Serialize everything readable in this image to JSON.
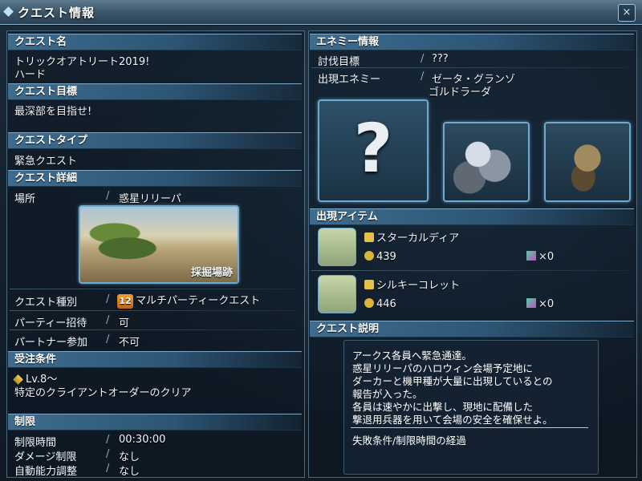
{
  "window": {
    "title": "クエスト情報",
    "close_icon": "×"
  },
  "left": {
    "quest_name": {
      "header": "クエスト名",
      "line1": "トリックオアトリート2019!",
      "line2": "ハード"
    },
    "quest_goal": {
      "header": "クエスト目標",
      "text": "最深部を目指せ!"
    },
    "quest_type": {
      "header": "クエストタイプ",
      "text": "緊急クエスト"
    },
    "quest_detail": {
      "header": "クエスト詳細",
      "location_label": "場所",
      "location_value": "惑星リリーパ",
      "area_caption": "採掘場跡",
      "kind_label": "クエスト種別",
      "kind_value": "マルチパーティークエスト",
      "kind_badge": "12",
      "party_invite_label": "パーティー招待",
      "party_invite_value": "可",
      "partner_label": "パートナー参加",
      "partner_value": "不可"
    },
    "conditions": {
      "header": "受注条件",
      "level": "Lv.8～",
      "order": "特定のクライアントオーダーのクリア"
    },
    "limits": {
      "header": "制限",
      "time_label": "制限時間",
      "time_value": "00:30:00",
      "damage_label": "ダメージ制限",
      "damage_value": "なし",
      "auto_label": "自動能力調整",
      "auto_value": "なし"
    },
    "slash": "/"
  },
  "right": {
    "enemy": {
      "header": "エネミー情報",
      "target_label": "討伐目標",
      "target_value": "???",
      "appear_label": "出現エネミー",
      "appear_value1": "ゼータ・グランゾ",
      "appear_value2": "ゴルドラーダ",
      "unknown_mark": "?"
    },
    "items": {
      "header": "出現アイテム",
      "list": [
        {
          "name": "スターカルディア",
          "count": "439",
          "owned": "×0"
        },
        {
          "name": "シルキーコレット",
          "count": "446",
          "owned": "×0"
        }
      ]
    },
    "description": {
      "header": "クエスト説明",
      "lines": [
        "アークス各員へ緊急通達。",
        "惑星リリーパのハロウィン会場予定地に",
        "ダーカーと機甲種が大量に出現しているとの",
        "報告が入った。",
        "各員は速やかに出撃し、現地に配備した",
        "撃退用兵器を用いて会場の安全を確保せよ。"
      ],
      "fail_condition": "失敗条件/制限時間の経過"
    }
  },
  "colors": {
    "header_blue": "#2d5676",
    "accent": "#6ea9cf",
    "text": "#f2f6fa"
  }
}
